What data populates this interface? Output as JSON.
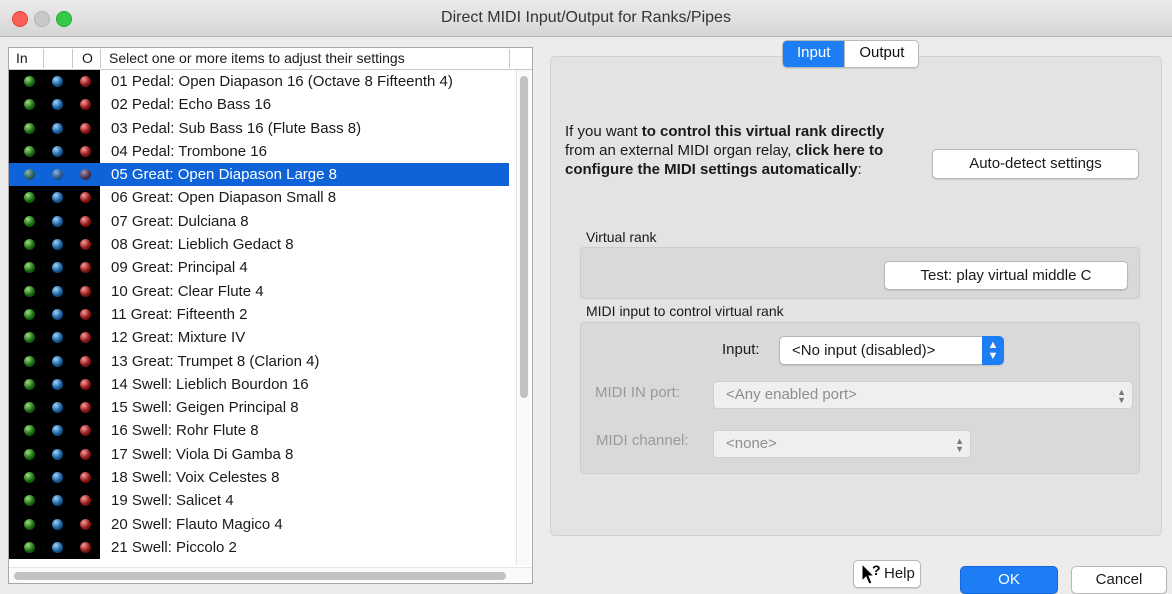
{
  "window": {
    "title": "Direct MIDI Input/Output for Ranks/Pipes"
  },
  "list": {
    "header": {
      "in": "In",
      "out": "O",
      "label": "Select one or more items to adjust their settings"
    },
    "items": [
      "01 Pedal: Open Diapason 16 (Octave 8 Fifteenth 4)",
      "02 Pedal: Echo Bass 16",
      "03 Pedal: Sub Bass 16 (Flute Bass 8)",
      "04 Pedal: Trombone 16",
      "05 Great: Open Diapason Large 8",
      "06 Great: Open Diapason Small 8",
      "07 Great: Dulciana 8",
      "08 Great: Lieblich Gedact 8",
      "09 Great: Principal 4",
      "10 Great: Clear Flute 4",
      "11 Great: Fifteenth 2",
      "12 Great: Mixture IV",
      "13 Great: Trumpet 8 (Clarion 4)",
      "14 Swell: Lieblich Bourdon 16",
      "15 Swell: Geigen Principal 8",
      "16 Swell: Rohr Flute 8",
      "17 Swell: Viola Di Gamba 8",
      "18 Swell: Voix Celestes 8",
      "19 Swell: Salicet 4",
      "20 Swell: Flauto Magico 4",
      "21 Swell: Piccolo 2"
    ],
    "selected_index": 4
  },
  "tabs": {
    "input": "Input",
    "output": "Output",
    "active": "input"
  },
  "intro": {
    "p1": "If you want ",
    "b1": "to control this virtual rank directly",
    "p2": " from an external MIDI organ relay, ",
    "b2": "click here to configure the MIDI settings automatically",
    "p3": ":"
  },
  "buttons": {
    "autodetect": "Auto-detect settings",
    "test": "Test: play virtual middle C",
    "help": "Help",
    "ok": "OK",
    "cancel": "Cancel"
  },
  "sections": {
    "virtual_rank": "Virtual rank",
    "midi_input": "MIDI input to control virtual rank"
  },
  "fields": {
    "input_label": "Input:",
    "input_value": "<No input (disabled)>",
    "port_label": "MIDI IN port:",
    "port_value": "<Any enabled port>",
    "channel_label": "MIDI channel:",
    "channel_value": "<none>"
  },
  "colors": {
    "accent": "#1c7df5",
    "selection": "#0f63d8"
  }
}
